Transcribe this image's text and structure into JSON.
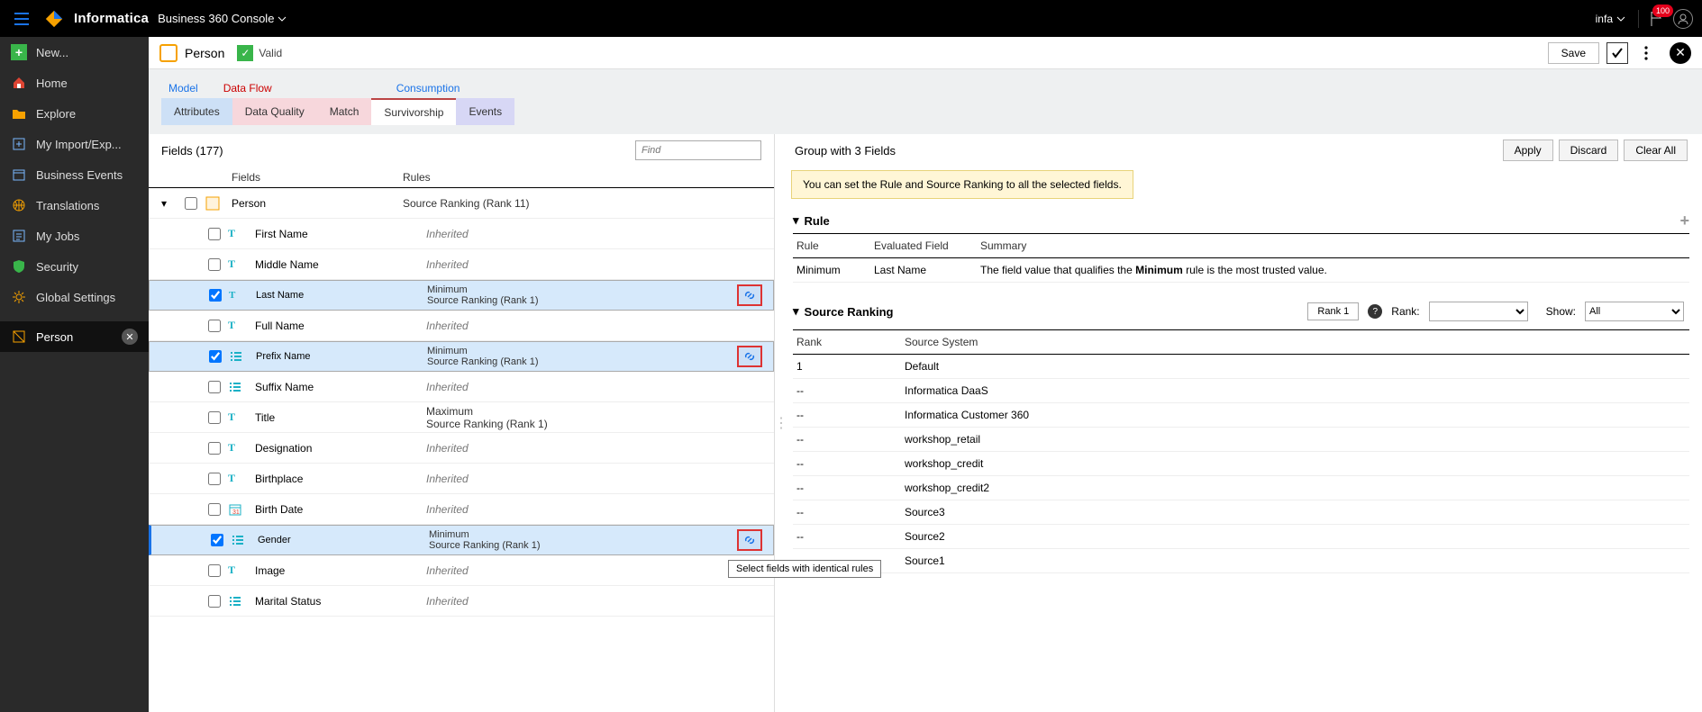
{
  "top": {
    "brand": "Informatica",
    "context": "Business 360 Console",
    "user": "infa",
    "notif_count": "100"
  },
  "nav": {
    "new": "New...",
    "home": "Home",
    "explore": "Explore",
    "impexp": "My Import/Exp...",
    "bizevents": "Business Events",
    "translations": "Translations",
    "myjobs": "My Jobs",
    "security": "Security",
    "globset": "Global Settings",
    "active": "Person"
  },
  "page": {
    "title": "Person",
    "valid": "Valid",
    "save": "Save"
  },
  "tabs": {
    "model": "Model",
    "dataflow": "Data Flow",
    "consumption": "Consumption",
    "attributes": "Attributes",
    "dq": "Data Quality",
    "match": "Match",
    "survivorship": "Survivorship",
    "events": "Events"
  },
  "left": {
    "title": "Fields (177)",
    "find_ph": "Find",
    "col_fields": "Fields",
    "col_rules": "Rules",
    "rows": {
      "root": {
        "label": "Person",
        "rule": "Source Ranking (Rank 11)"
      },
      "first": {
        "label": "First Name",
        "rule_inh": "Inherited"
      },
      "middle": {
        "label": "Middle Name",
        "rule_inh": "Inherited"
      },
      "last": {
        "label": "Last Name",
        "r1": "Minimum",
        "r2": "Source Ranking (Rank 1)"
      },
      "full": {
        "label": "Full Name",
        "rule_inh": "Inherited"
      },
      "prefix": {
        "label": "Prefix Name",
        "r1": "Minimum",
        "r2": "Source Ranking (Rank 1)"
      },
      "suffix": {
        "label": "Suffix Name",
        "rule_inh": "Inherited"
      },
      "title": {
        "label": "Title",
        "r1": "Maximum",
        "r2": "Source Ranking (Rank 1)"
      },
      "desig": {
        "label": "Designation",
        "rule_inh": "Inherited"
      },
      "birthplace": {
        "label": "Birthplace",
        "rule_inh": "Inherited"
      },
      "birthdate": {
        "label": "Birth Date",
        "rule_inh": "Inherited"
      },
      "gender": {
        "label": "Gender",
        "r1": "Minimum",
        "r2": "Source Ranking (Rank 1)"
      },
      "image": {
        "label": "Image",
        "rule_inh": "Inherited"
      },
      "marital": {
        "label": "Marital Status",
        "rule_inh": "Inherited"
      }
    },
    "tooltip": "Select fields with identical rules"
  },
  "right": {
    "title": "Group with 3 Fields",
    "apply": "Apply",
    "discard": "Discard",
    "clearall": "Clear All",
    "notice": "You can set the Rule and Source Ranking to all the selected fields.",
    "rule_header": "Rule",
    "cols": {
      "rule": "Rule",
      "eval": "Evaluated Field",
      "summary": "Summary"
    },
    "rule_row": {
      "rule": "Minimum",
      "eval": "Last Name",
      "summary_pre": "The field value that qualifies the ",
      "summary_bold": "Minimum",
      "summary_post": " rule is the most trusted value."
    },
    "sr": {
      "header": "Source Ranking",
      "rank_pill": "Rank 1",
      "rank_lbl": "Rank:",
      "show_lbl": "Show:",
      "show_val": "All",
      "cols": {
        "rank": "Rank",
        "src": "Source System"
      },
      "rows": [
        {
          "rank": "1",
          "src": "Default"
        },
        {
          "rank": "--",
          "src": "Informatica DaaS"
        },
        {
          "rank": "--",
          "src": "Informatica Customer 360"
        },
        {
          "rank": "--",
          "src": "workshop_retail"
        },
        {
          "rank": "--",
          "src": "workshop_credit"
        },
        {
          "rank": "--",
          "src": "workshop_credit2"
        },
        {
          "rank": "--",
          "src": "Source3"
        },
        {
          "rank": "--",
          "src": "Source2"
        },
        {
          "rank": "--",
          "src": "Source1"
        }
      ]
    }
  }
}
